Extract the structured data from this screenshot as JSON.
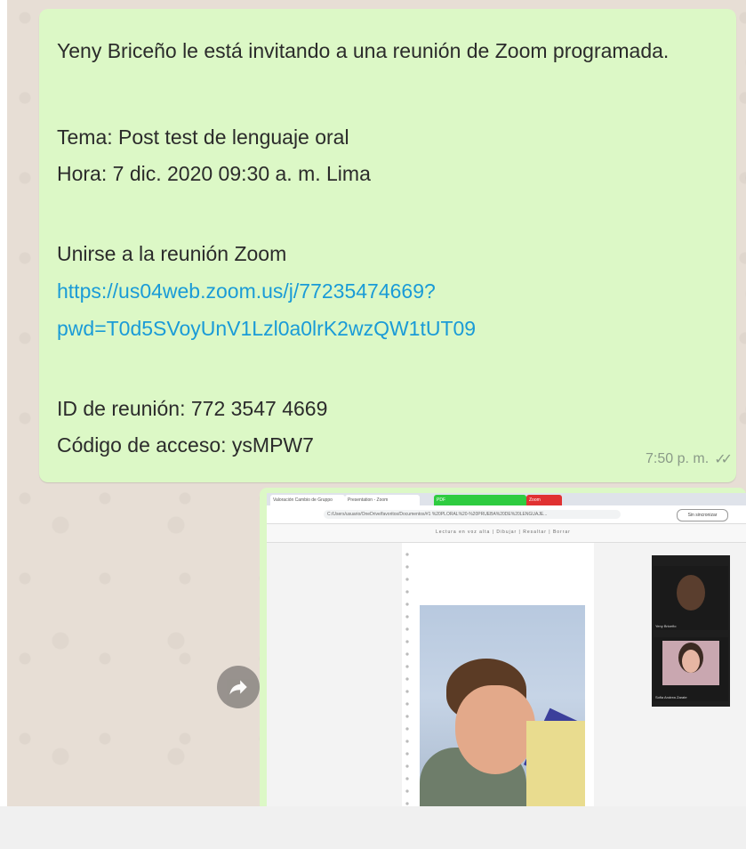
{
  "message": {
    "line1": "Yeny Briceño le está invitando a una reunión de Zoom programada.",
    "topic": "Tema: Post test de lenguaje oral",
    "time": "Hora: 7 dic. 2020 09:30 a. m. Lima",
    "join_label": "Unirse a la reunión Zoom",
    "link_line1": "https://us04web.zoom.us/j/77235474669?",
    "link_line2": "pwd=T0d5SVoyUnV1Lzl0a0lrK2wzQW1tUT09",
    "meeting_id": "ID de reunión: 772 3547 4669",
    "access_code": "Código de acceso: ysMPW7",
    "timestamp": "7:50 p. m.",
    "status_icon": "double-check-read-icon",
    "status_color": "#4fb6ec"
  },
  "forward_button": {
    "icon": "forward-arrow-icon"
  },
  "image_message": {
    "embedded_screenshot": {
      "tabs": [
        "Valoración Cambio de Gruppo",
        "Presentation - Zoom",
        "PDF",
        "Zoom"
      ],
      "address": "C:/Users/usuario/OneDrive/favoritos/Documentos/#1 %20PLORAL%20-%20PRUEBA%20DE%20LENGUAJE...",
      "profile_label": "Sin sincronizar",
      "pdf_tools": "Lectura en voz alta | Dibujar | Resaltar | Borrar",
      "video_names": [
        "Yeny Briceño",
        "Sofia Andrea Zarate"
      ]
    }
  },
  "colors": {
    "bubble": "#dcf8c6",
    "chat_background": "#e7ded5",
    "link": "#1a9bd7"
  }
}
